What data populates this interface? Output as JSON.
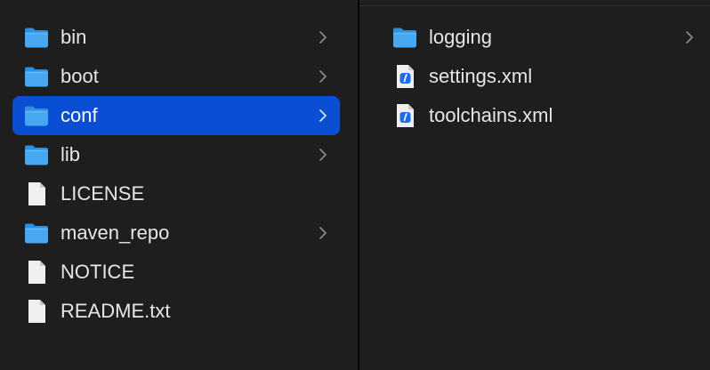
{
  "colors": {
    "background": "#1e1e1e",
    "selection": "#0a4fd3",
    "folder": "#3fa3ee",
    "text": "#e6e6e6",
    "chevron": "#8c8c8c"
  },
  "column1": {
    "items": [
      {
        "label": "bin",
        "kind": "folder",
        "selected": false,
        "icon": "folder-icon"
      },
      {
        "label": "boot",
        "kind": "folder",
        "selected": false,
        "icon": "folder-icon"
      },
      {
        "label": "conf",
        "kind": "folder",
        "selected": true,
        "icon": "folder-icon"
      },
      {
        "label": "lib",
        "kind": "folder",
        "selected": false,
        "icon": "folder-icon"
      },
      {
        "label": "LICENSE",
        "kind": "file",
        "selected": false,
        "icon": "document-icon"
      },
      {
        "label": "maven_repo",
        "kind": "folder",
        "selected": false,
        "icon": "folder-icon"
      },
      {
        "label": "NOTICE",
        "kind": "file",
        "selected": false,
        "icon": "document-icon"
      },
      {
        "label": "README.txt",
        "kind": "file",
        "selected": false,
        "icon": "document-icon"
      }
    ]
  },
  "column2": {
    "items": [
      {
        "label": "logging",
        "kind": "folder",
        "icon": "folder-icon"
      },
      {
        "label": "settings.xml",
        "kind": "xml",
        "icon": "xml-file-icon"
      },
      {
        "label": "toolchains.xml",
        "kind": "xml",
        "icon": "xml-file-icon"
      }
    ]
  }
}
